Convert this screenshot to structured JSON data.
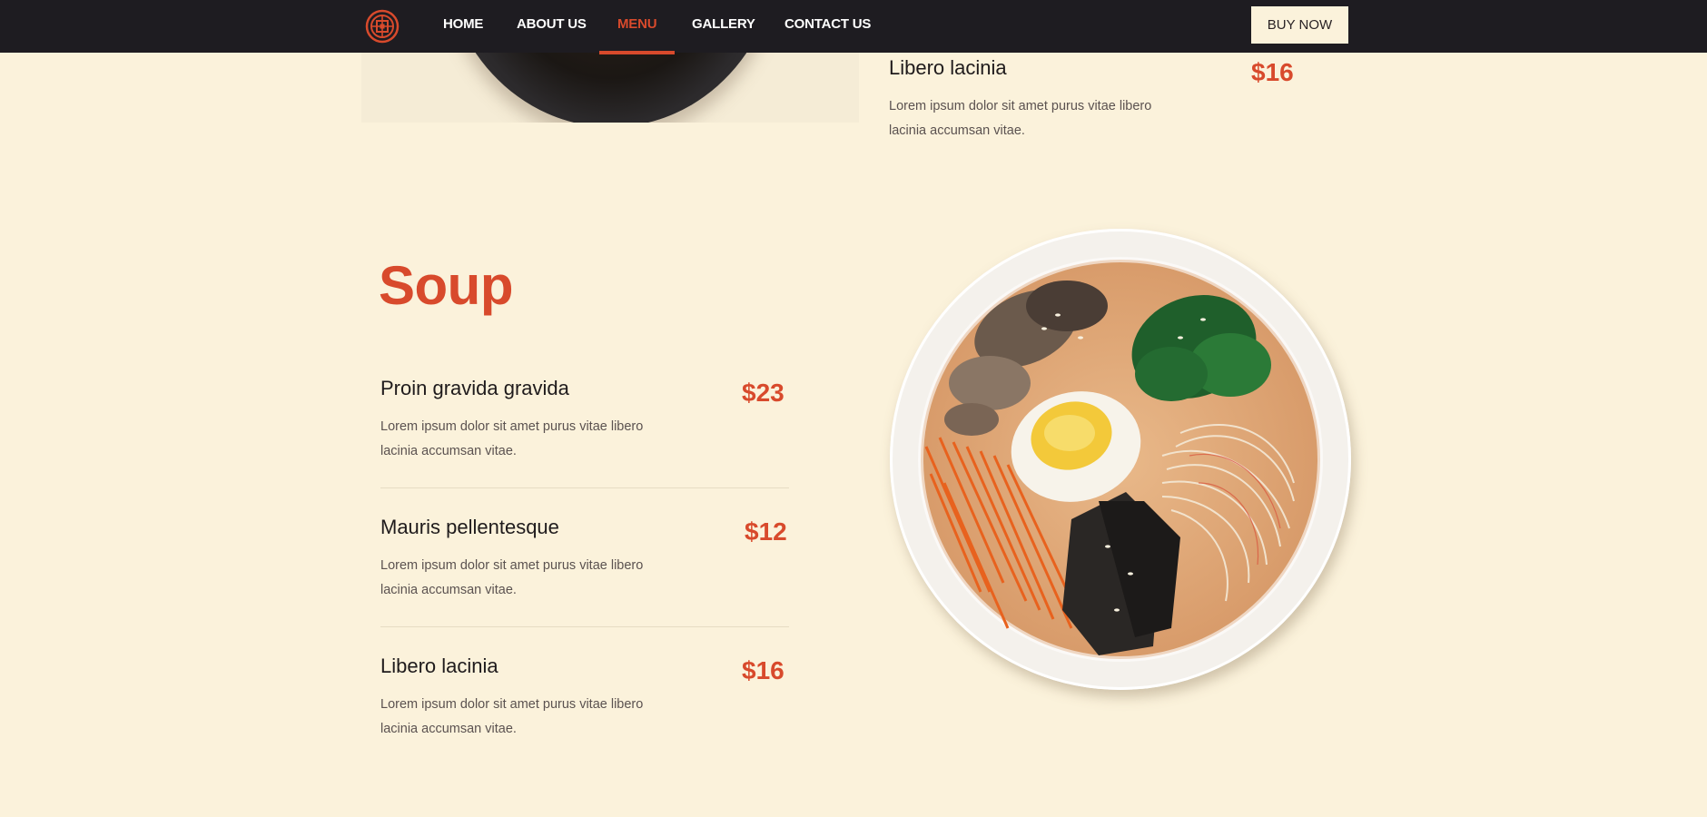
{
  "nav": {
    "logo_icon": "ornamental-emblem-icon",
    "links": [
      "HOME",
      "ABOUT US",
      "MENU",
      "GALLERY",
      "CONTACT US"
    ],
    "active_index": 2,
    "buy_label": "BUY NOW"
  },
  "colors": {
    "accent": "#d84a2c",
    "background": "#fbf2db",
    "nav_background": "#1e1c21"
  },
  "previous_section": {
    "item": {
      "title": "Libero lacinia",
      "price": "$16",
      "description": "Lorem ipsum dolor sit amet purus vitae libero lacinia accumsan vitae."
    }
  },
  "soup": {
    "title": "Soup",
    "items": [
      {
        "title": "Proin gravida gravida",
        "price": "$23",
        "description": "Lorem ipsum dolor sit amet purus vitae libero lacinia accumsan vitae."
      },
      {
        "title": "Mauris pellentesque",
        "price": "$12",
        "description": "Lorem ipsum dolor sit amet purus vitae libero lacinia accumsan vitae."
      },
      {
        "title": "Libero lacinia",
        "price": "$16",
        "description": "Lorem ipsum dolor sit amet purus vitae libero lacinia accumsan vitae."
      }
    ]
  }
}
